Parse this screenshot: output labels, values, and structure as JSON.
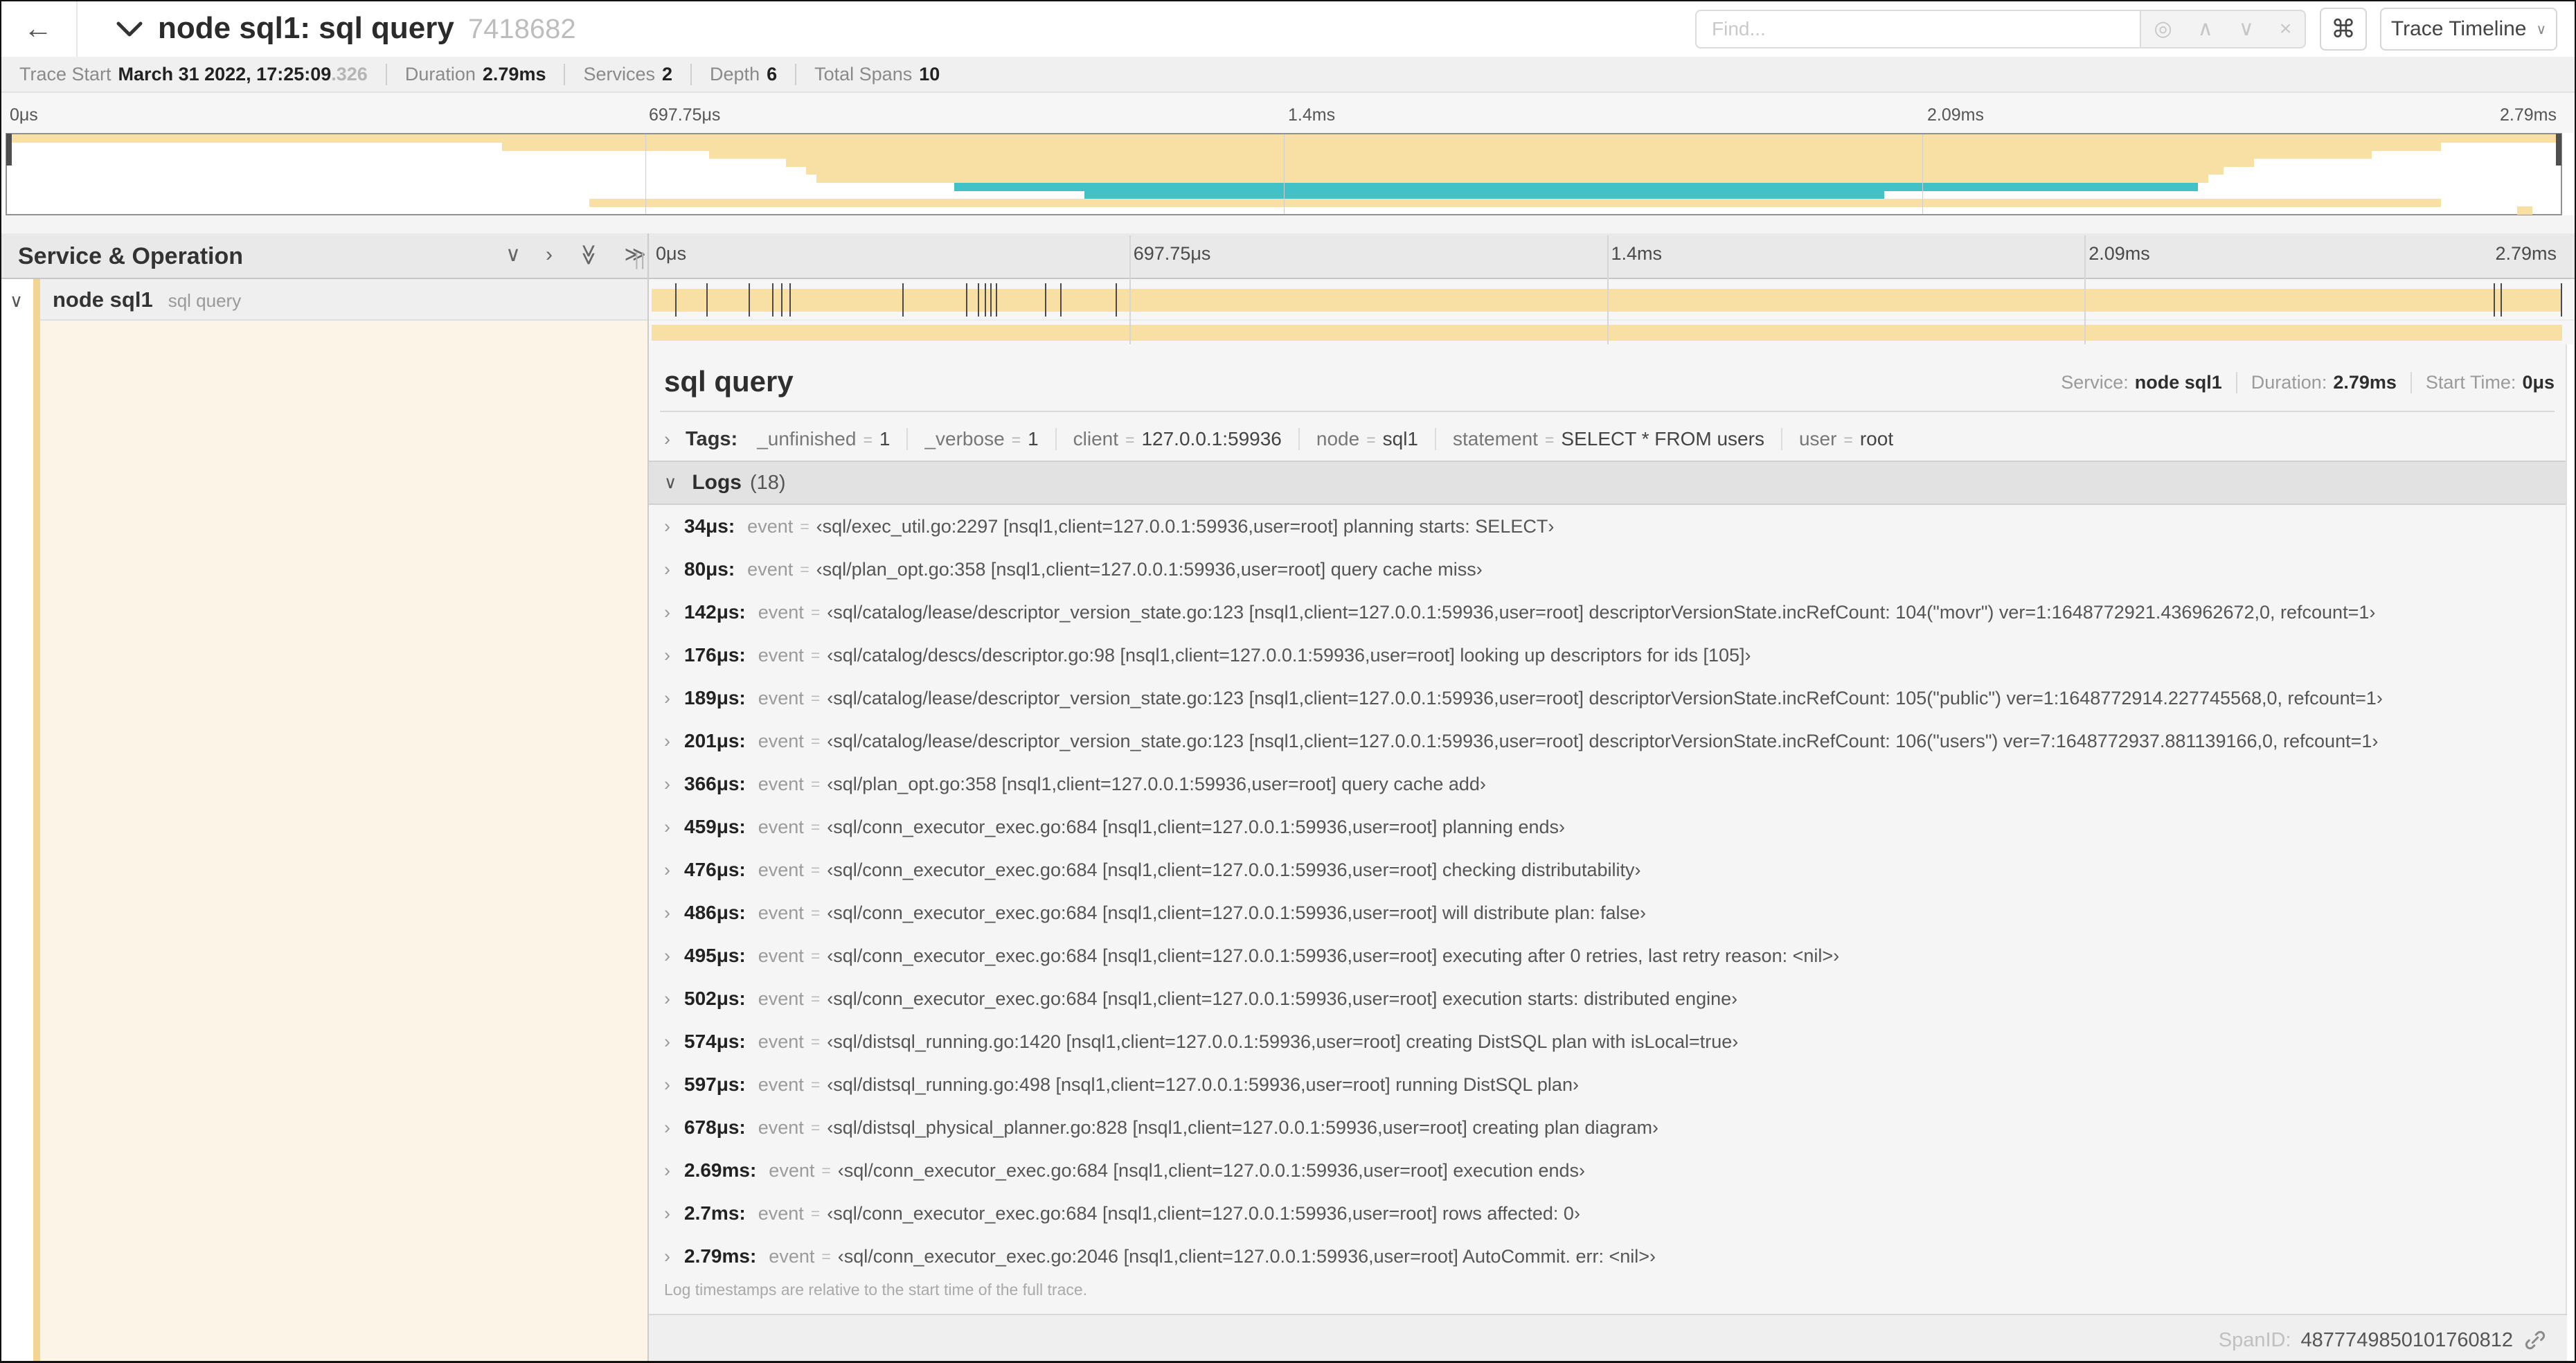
{
  "colors": {
    "tan": "#f8dfa4",
    "teal": "#42c2c6",
    "stripe": "#f3d492",
    "cream": "#fcf4e6",
    "grid": "#cfcfcf"
  },
  "titlebar": {
    "back_icon": "←",
    "title": "node sql1: sql query",
    "trace_id": "7418682",
    "find_placeholder": "Find...",
    "find_icons": [
      "◎",
      "∧",
      "∨",
      "×"
    ],
    "shortcut_icon": "⌘",
    "view_button": "Trace Timeline",
    "view_button_chevron": "∨"
  },
  "trace_meta": [
    {
      "label": "Trace Start",
      "value": "March 31 2022, 17:25:09",
      "suffix": ".326"
    },
    {
      "label": "Duration",
      "value": "2.79ms",
      "suffix": ""
    },
    {
      "label": "Services",
      "value": "2",
      "suffix": ""
    },
    {
      "label": "Depth",
      "value": "6",
      "suffix": ""
    },
    {
      "label": "Total Spans",
      "value": "10",
      "suffix": ""
    }
  ],
  "timeline": {
    "ticks": [
      {
        "label": "0μs",
        "pos": 0
      },
      {
        "label": "697.75μs",
        "pos": 25
      },
      {
        "label": "1.4ms",
        "pos": 50
      },
      {
        "label": "2.09ms",
        "pos": 75
      },
      {
        "label": "2.79ms",
        "pos": 100
      }
    ]
  },
  "minimap": {
    "bars": [
      {
        "row": 1,
        "start": 0,
        "end": 100,
        "color": "tan"
      },
      {
        "row": 2,
        "start": 19.4,
        "end": 95.3,
        "color": "tan"
      },
      {
        "row": 3,
        "start": 27.5,
        "end": 92.6,
        "color": "tan"
      },
      {
        "row": 4,
        "start": 30.5,
        "end": 88.0,
        "color": "tan"
      },
      {
        "row": 5,
        "start": 31.3,
        "end": 86.8,
        "color": "tan"
      },
      {
        "row": 6,
        "start": 31.7,
        "end": 86.2,
        "color": "tan"
      },
      {
        "row": 7,
        "start": 37.1,
        "end": 85.8,
        "color": "teal"
      },
      {
        "row": 8,
        "start": 42.2,
        "end": 73.5,
        "color": "teal"
      },
      {
        "row": 9,
        "start": 22.8,
        "end": 95.3,
        "color": "tan"
      },
      {
        "row": 10,
        "start": 98.3,
        "end": 98.9,
        "color": "tan"
      }
    ]
  },
  "columns_header": {
    "title": "Service & Operation",
    "collapse_one_icon": "∨",
    "expand_one_icon": "›",
    "collapse_all_icon": "≫",
    "expand_all_icon": "≫",
    "grip": "||"
  },
  "span_row": {
    "collapse_icon": "∨",
    "service": "node sql1",
    "operation": "sql query",
    "log_marker_pct": [
      1.22,
      2.87,
      5.09,
      6.31,
      6.77,
      7.2,
      13.12,
      16.45,
      17.06,
      17.42,
      17.74,
      18.0,
      20.57,
      21.4,
      24.3,
      96.42,
      96.77,
      99.93
    ]
  },
  "detail": {
    "title": "sql query",
    "summary": [
      {
        "label": "Service:",
        "value": "node sql1"
      },
      {
        "label": "Duration:",
        "value": "2.79ms"
      },
      {
        "label": "Start Time:",
        "value": "0μs"
      }
    ],
    "tags": {
      "chevron": "›",
      "label": "Tags:",
      "eq": "=",
      "items": [
        {
          "key": "_unfinished",
          "value": "1"
        },
        {
          "key": "_verbose",
          "value": "1"
        },
        {
          "key": "client",
          "value": "127.0.0.1:59936"
        },
        {
          "key": "node",
          "value": "sql1"
        },
        {
          "key": "statement",
          "value": "SELECT * FROM users"
        },
        {
          "key": "user",
          "value": "root"
        }
      ]
    },
    "logs": {
      "chevron": "∨",
      "label": "Logs",
      "count": "(18)",
      "row_chevron": "›",
      "field": "event",
      "eq": "=",
      "rows": [
        {
          "time": "34μs:",
          "value": "‹sql/exec_util.go:2297 [nsql1,client=127.0.0.1:59936,user=root] planning starts: SELECT›"
        },
        {
          "time": "80μs:",
          "value": "‹sql/plan_opt.go:358 [nsql1,client=127.0.0.1:59936,user=root] query cache miss›"
        },
        {
          "time": "142μs:",
          "value": "‹sql/catalog/lease/descriptor_version_state.go:123 [nsql1,client=127.0.0.1:59936,user=root] descriptorVersionState.incRefCount: 104(\"movr\") ver=1:1648772921.436962672,0, refcount=1›"
        },
        {
          "time": "176μs:",
          "value": "‹sql/catalog/descs/descriptor.go:98 [nsql1,client=127.0.0.1:59936,user=root] looking up descriptors for ids [105]›"
        },
        {
          "time": "189μs:",
          "value": "‹sql/catalog/lease/descriptor_version_state.go:123 [nsql1,client=127.0.0.1:59936,user=root] descriptorVersionState.incRefCount: 105(\"public\") ver=1:1648772914.227745568,0, refcount=1›"
        },
        {
          "time": "201μs:",
          "value": "‹sql/catalog/lease/descriptor_version_state.go:123 [nsql1,client=127.0.0.1:59936,user=root] descriptorVersionState.incRefCount: 106(\"users\") ver=7:1648772937.881139166,0, refcount=1›"
        },
        {
          "time": "366μs:",
          "value": "‹sql/plan_opt.go:358 [nsql1,client=127.0.0.1:59936,user=root] query cache add›"
        },
        {
          "time": "459μs:",
          "value": "‹sql/conn_executor_exec.go:684 [nsql1,client=127.0.0.1:59936,user=root] planning ends›"
        },
        {
          "time": "476μs:",
          "value": "‹sql/conn_executor_exec.go:684 [nsql1,client=127.0.0.1:59936,user=root] checking distributability›"
        },
        {
          "time": "486μs:",
          "value": "‹sql/conn_executor_exec.go:684 [nsql1,client=127.0.0.1:59936,user=root] will distribute plan: false›"
        },
        {
          "time": "495μs:",
          "value": "‹sql/conn_executor_exec.go:684 [nsql1,client=127.0.0.1:59936,user=root] executing after 0 retries, last retry reason: <nil>›"
        },
        {
          "time": "502μs:",
          "value": "‹sql/conn_executor_exec.go:684 [nsql1,client=127.0.0.1:59936,user=root] execution starts: distributed engine›"
        },
        {
          "time": "574μs:",
          "value": "‹sql/distsql_running.go:1420 [nsql1,client=127.0.0.1:59936,user=root] creating DistSQL plan with isLocal=true›"
        },
        {
          "time": "597μs:",
          "value": "‹sql/distsql_running.go:498 [nsql1,client=127.0.0.1:59936,user=root] running DistSQL plan›"
        },
        {
          "time": "678μs:",
          "value": "‹sql/distsql_physical_planner.go:828 [nsql1,client=127.0.0.1:59936,user=root] creating plan diagram›"
        },
        {
          "time": "2.69ms:",
          "value": "‹sql/conn_executor_exec.go:684 [nsql1,client=127.0.0.1:59936,user=root] execution ends›"
        },
        {
          "time": "2.7ms:",
          "value": "‹sql/conn_executor_exec.go:684 [nsql1,client=127.0.0.1:59936,user=root] rows affected: 0›"
        },
        {
          "time": "2.79ms:",
          "value": "‹sql/conn_executor_exec.go:2046 [nsql1,client=127.0.0.1:59936,user=root] AutoCommit. err: <nil>›"
        }
      ]
    },
    "note": "Log timestamps are relative to the start time of the full trace.",
    "footer": {
      "label": "SpanID:",
      "value": "4877749850101760812"
    }
  }
}
